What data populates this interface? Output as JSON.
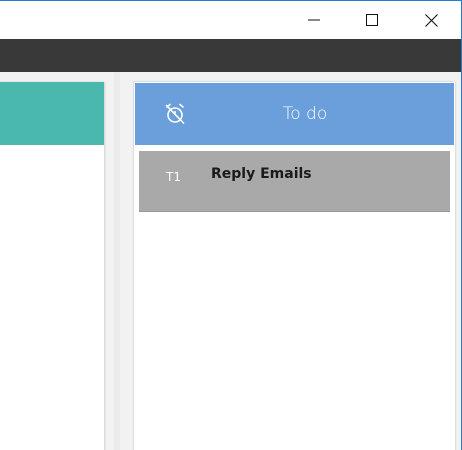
{
  "window": {
    "buttons": {
      "minimize": "minimize-icon",
      "maximize": "maximize-icon",
      "close": "close-icon"
    },
    "colors": {
      "toolbar": "#393939",
      "accent_border": "#1f7dd6"
    }
  },
  "columns": [
    {
      "title": "",
      "header_color": "#4bb8ad",
      "tasks": []
    },
    {
      "title": "To do",
      "icon": "alarm-off-icon",
      "header_color": "#6a9fdc",
      "tasks": [
        {
          "id": "T1",
          "title": "Reply Emails",
          "color": "#a9a9a9"
        }
      ]
    }
  ]
}
